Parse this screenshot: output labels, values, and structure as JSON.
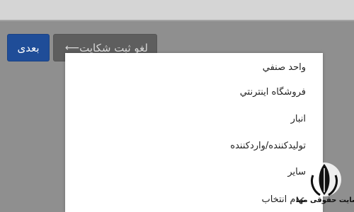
{
  "buttons": {
    "next_label": "بعدی",
    "cancel_label": "لغو ثبت شکایت",
    "cancel_icon": "arrow-left-icon"
  },
  "dropdown": {
    "options": [
      "واحد صنفي",
      "فروشگاه اینترنتي",
      "انبار",
      "تولیدکننده/واردکننده",
      "سایر",
      "عدم انتخاب"
    ]
  },
  "watermark": {
    "text": "سایت حقوقی مها"
  },
  "colors": {
    "next_button": "#1f4d98",
    "cancel_button": "#5e5e5e",
    "overlay": "#8f8f8f"
  }
}
